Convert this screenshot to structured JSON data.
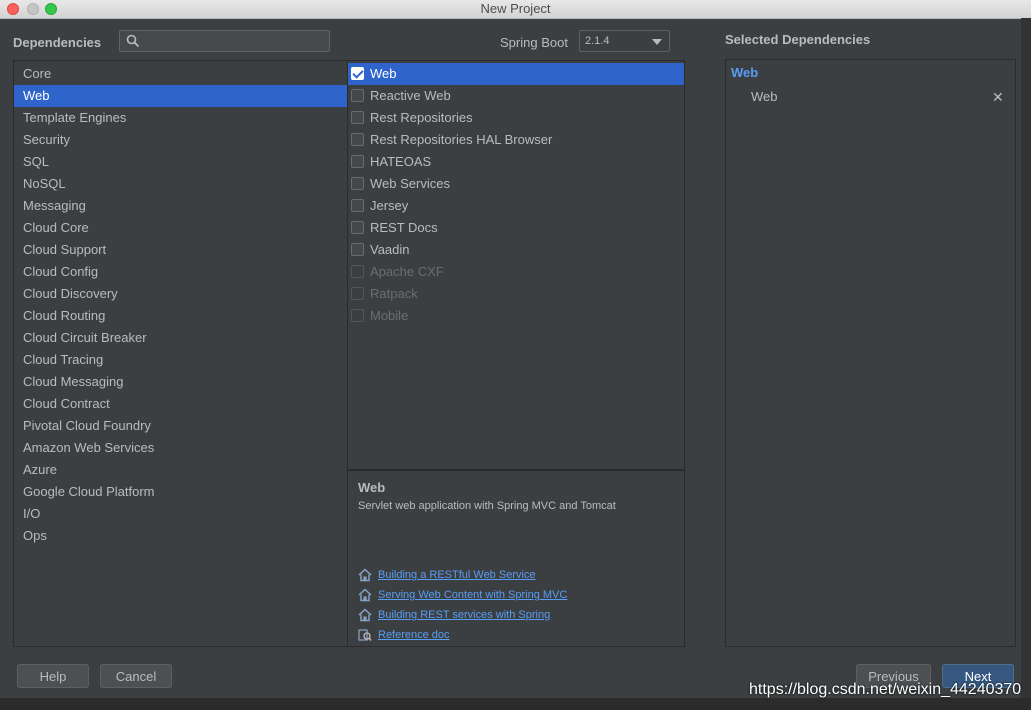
{
  "window": {
    "title": "New Project"
  },
  "header": {
    "dependencies_label": "Dependencies",
    "search": {
      "value": "",
      "placeholder": ""
    },
    "spring_boot_label": "Spring Boot",
    "spring_boot_version": "2.1.4"
  },
  "categories": [
    "Core",
    "Web",
    "Template Engines",
    "Security",
    "SQL",
    "NoSQL",
    "Messaging",
    "Cloud Core",
    "Cloud Support",
    "Cloud Config",
    "Cloud Discovery",
    "Cloud Routing",
    "Cloud Circuit Breaker",
    "Cloud Tracing",
    "Cloud Messaging",
    "Cloud Contract",
    "Pivotal Cloud Foundry",
    "Amazon Web Services",
    "Azure",
    "Google Cloud Platform",
    "I/O",
    "Ops"
  ],
  "selected_category": "Web",
  "dependencies": [
    {
      "label": "Web",
      "checked": true,
      "enabled": true,
      "highlighted": true
    },
    {
      "label": "Reactive Web",
      "checked": false,
      "enabled": true
    },
    {
      "label": "Rest Repositories",
      "checked": false,
      "enabled": true
    },
    {
      "label": "Rest Repositories HAL Browser",
      "checked": false,
      "enabled": true
    },
    {
      "label": "HATEOAS",
      "checked": false,
      "enabled": true
    },
    {
      "label": "Web Services",
      "checked": false,
      "enabled": true
    },
    {
      "label": "Jersey",
      "checked": false,
      "enabled": true
    },
    {
      "label": "REST Docs",
      "checked": false,
      "enabled": true
    },
    {
      "label": "Vaadin",
      "checked": false,
      "enabled": true
    },
    {
      "label": "Apache CXF",
      "checked": false,
      "enabled": false
    },
    {
      "label": "Ratpack",
      "checked": false,
      "enabled": false
    },
    {
      "label": "Mobile",
      "checked": false,
      "enabled": false
    }
  ],
  "description": {
    "title": "Web",
    "text": "Servlet web application with Spring MVC and Tomcat",
    "links": [
      {
        "label": "Building a RESTful Web Service",
        "icon": "guide-icon"
      },
      {
        "label": "Serving Web Content with Spring MVC",
        "icon": "guide-icon"
      },
      {
        "label": "Building REST services with Spring",
        "icon": "guide-icon"
      },
      {
        "label": "Reference doc",
        "icon": "reference-doc-icon"
      }
    ]
  },
  "selected_dependencies": {
    "title": "Selected Dependencies",
    "group": "Web",
    "items": [
      {
        "label": "Web",
        "remove_icon": "close-icon"
      }
    ]
  },
  "buttons": {
    "help": "Help",
    "cancel": "Cancel",
    "previous": "Previous",
    "next": "Next"
  },
  "watermark": "https://blog.csdn.net/weixin_44240370",
  "colors": {
    "background": "#3c3f41",
    "selection": "#2f65ca",
    "link": "#589df6",
    "primary_button": "#365880"
  }
}
